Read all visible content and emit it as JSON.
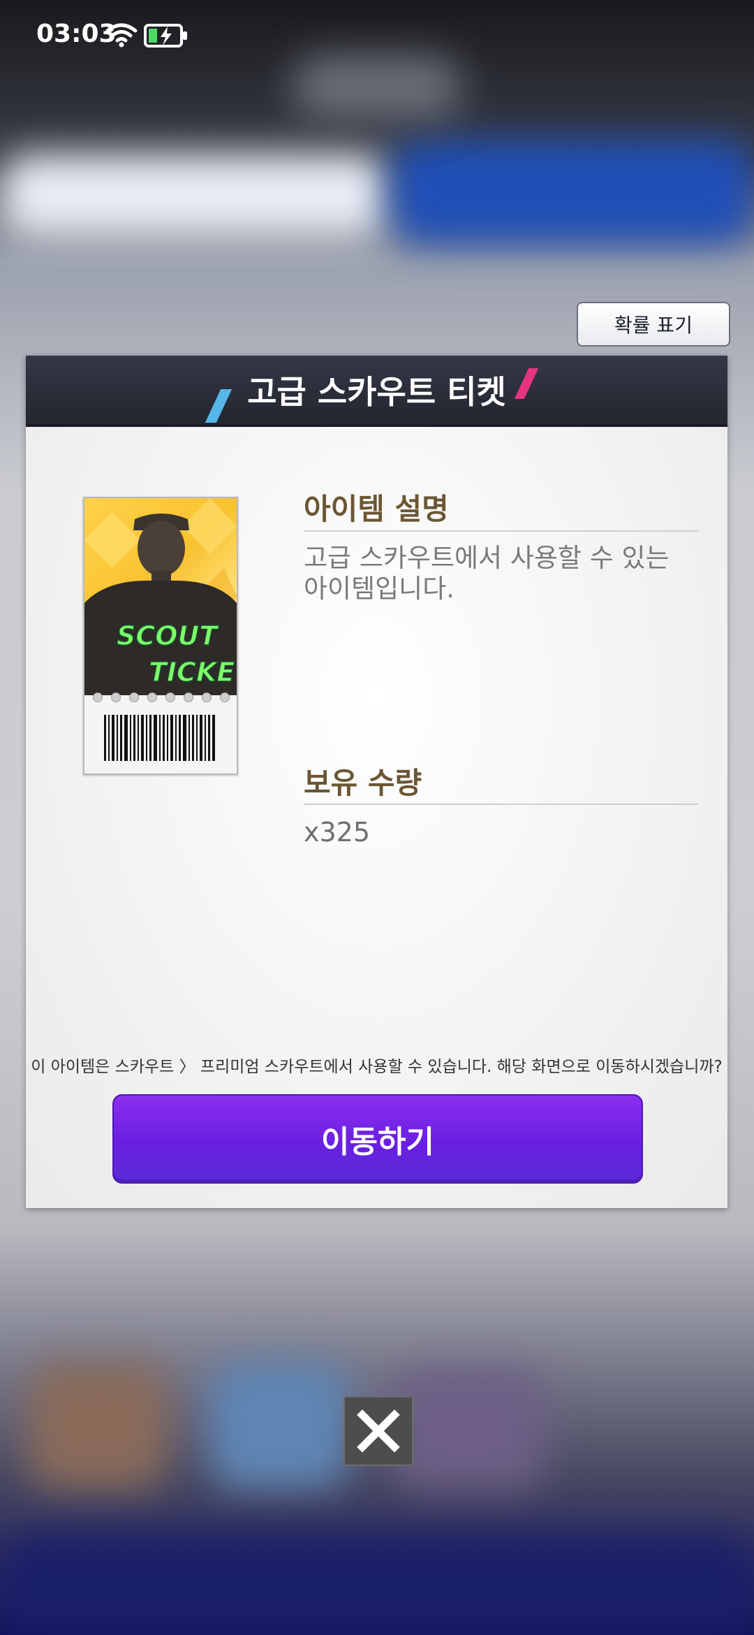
{
  "status_bar": {
    "time": "03:03"
  },
  "probability_button_label": "확률 표기",
  "dialog": {
    "title": "고급 스카우트 티켓",
    "item": {
      "art_line1": "SCOUT",
      "art_line2": "TICKET"
    },
    "description": {
      "heading": "아이템 설명",
      "text": "고급 스카우트에서 사용할 수 있는 아이템입니다."
    },
    "quantity": {
      "heading": "보유 수량",
      "value": "x325"
    },
    "notice": "이 아이템은 스카우트 〉 프리미엄 스카우트에서 사용할 수 있습니다. 해당 화면으로 이동하시겠습니까?",
    "move_button_label": "이동하기"
  },
  "colors": {
    "header_bg": "#2a2d38",
    "accent_purple": "#6a1fe0",
    "section_heading": "#6b5634",
    "slash_blue": "#56b6e8",
    "slash_pink": "#e6357f"
  }
}
